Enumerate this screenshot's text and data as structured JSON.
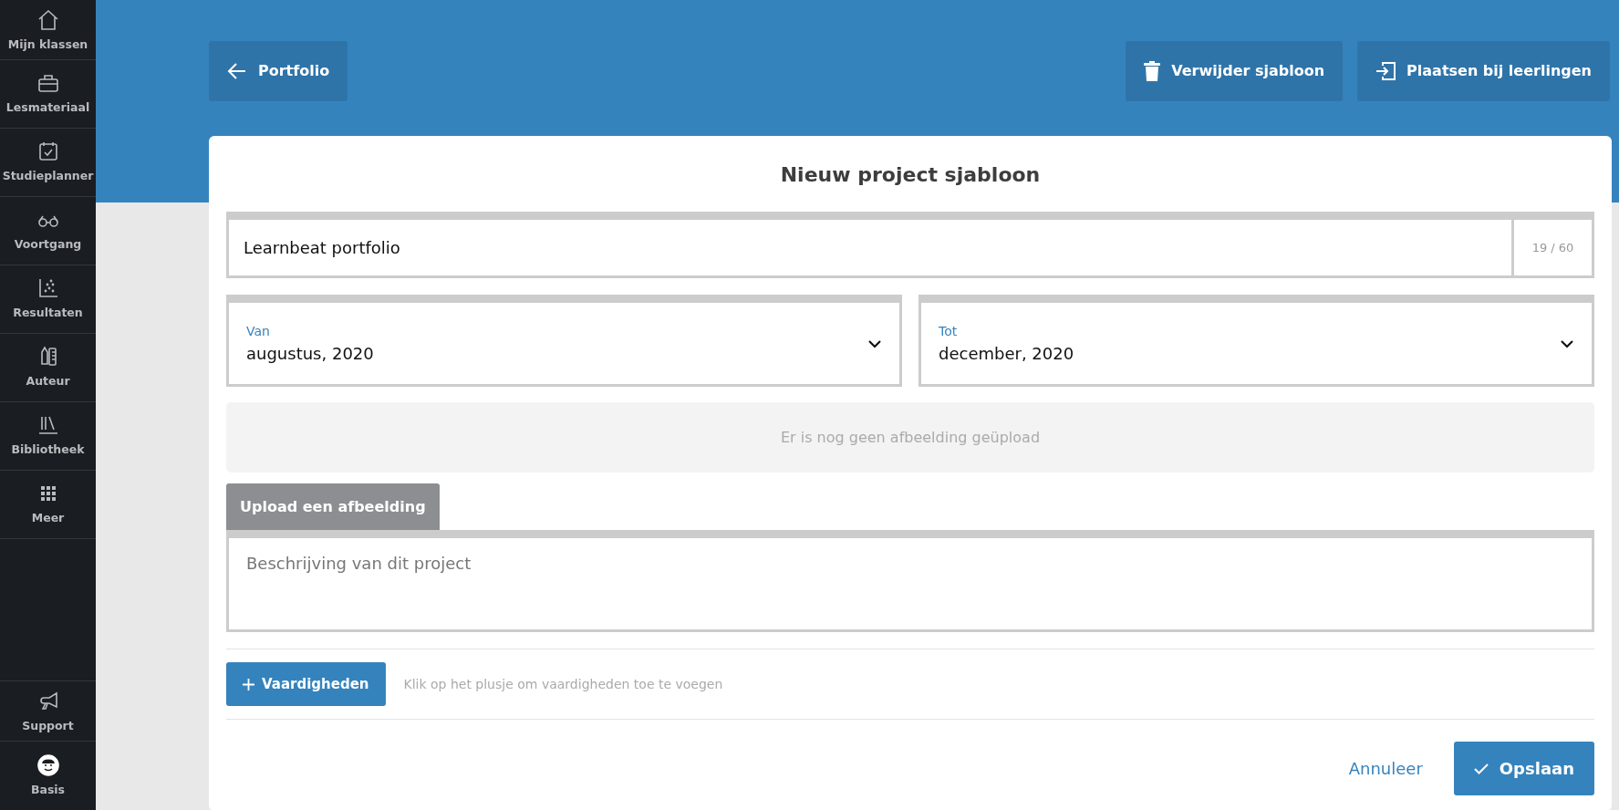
{
  "sidebar": {
    "items": [
      {
        "label": "Mijn klassen"
      },
      {
        "label": "Lesmateriaal"
      },
      {
        "label": "Studieplanner"
      },
      {
        "label": "Voortgang"
      },
      {
        "label": "Resultaten"
      },
      {
        "label": "Auteur"
      },
      {
        "label": "Bibliotheek"
      },
      {
        "label": "Meer"
      }
    ],
    "bottom_items": [
      {
        "label": "Support"
      },
      {
        "label": "Basis"
      }
    ]
  },
  "header": {
    "back_button": "Portfolio",
    "delete_button": "Verwijder sjabloon",
    "place_button": "Plaatsen bij leerlingen"
  },
  "form": {
    "title": "Nieuw project sjabloon",
    "name_field": {
      "value": "Learnbeat portfolio",
      "counter": "19 / 60"
    },
    "date_from": {
      "label": "Van",
      "value": "augustus, 2020"
    },
    "date_to": {
      "label": "Tot",
      "value": "december, 2020"
    },
    "image_notice": "Er is nog geen afbeelding geüpload",
    "upload_button": "Upload een afbeelding",
    "description": {
      "placeholder": "Beschrijving van dit project"
    },
    "skills_button": "Vaardigheden",
    "skills_hint": "Klik op het plusje om vaardigheden toe te voegen",
    "cancel_link": "Annuleer",
    "save_button": "Opslaan"
  }
}
